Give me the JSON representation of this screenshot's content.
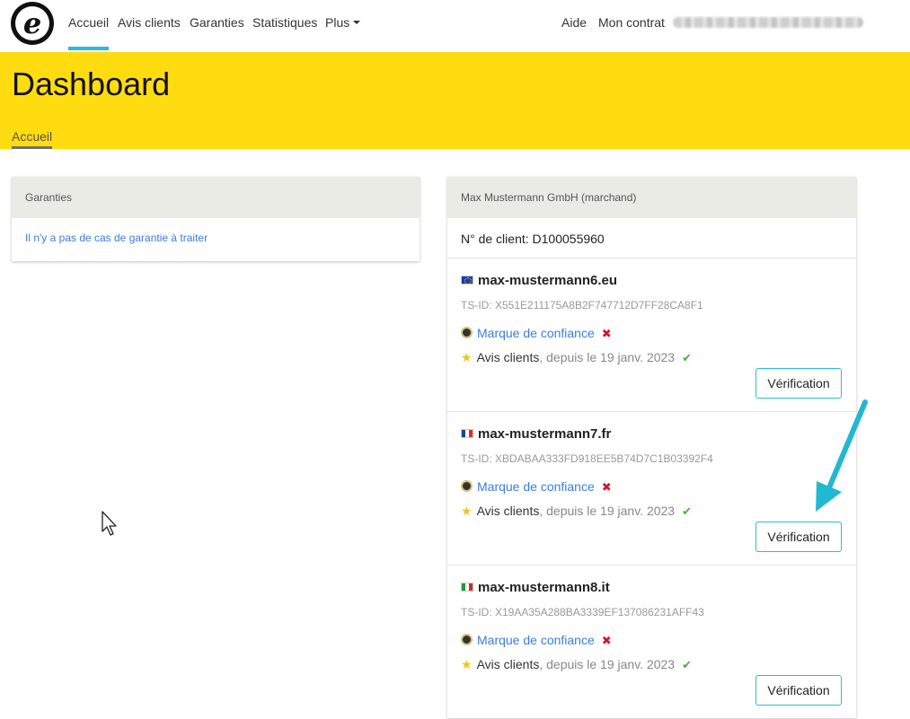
{
  "nav": {
    "logo_letter": "e",
    "items": [
      "Accueil",
      "Avis clients",
      "Garanties",
      "Statistiques",
      "Plus"
    ],
    "right": [
      "Aide",
      "Mon contrat"
    ]
  },
  "header": {
    "title": "Dashboard",
    "breadcrumb": "Accueil"
  },
  "guarantees": {
    "title": "Garanties",
    "message": "Il n'y a pas de cas de garantie à traiter"
  },
  "merchant": {
    "title": "Max Mustermann GmbH (marchand)",
    "client_number": "N° de client: D100055960",
    "shops": [
      {
        "flag": "eu",
        "domain": "max-mustermann6.eu",
        "ts_id": "TS-ID: X551E211175A8B2F747712D7FF28CA8F1",
        "trustmark_label": "Marque de confiance",
        "trustmark_status": "✖",
        "reviews_label": "Avis clients",
        "reviews_since": ", depuis le 19 janv. 2023",
        "reviews_status": "✔",
        "button": "Vérification"
      },
      {
        "flag": "fr",
        "domain": "max-mustermann7.fr",
        "ts_id": "TS-ID: XBDABAA333FD918EE5B74D7C1B03392F4",
        "trustmark_label": "Marque de confiance",
        "trustmark_status": "✖",
        "reviews_label": "Avis clients",
        "reviews_since": ", depuis le 19 janv. 2023",
        "reviews_status": "✔",
        "button": "Vérification"
      },
      {
        "flag": "it",
        "domain": "max-mustermann8.it",
        "ts_id": "TS-ID: X19AA35A288BA3339EF137086231AFF43",
        "trustmark_label": "Marque de confiance",
        "trustmark_status": "✖",
        "reviews_label": "Avis clients",
        "reviews_since": ", depuis le 19 janv. 2023",
        "reviews_status": "✔",
        "button": "Vérification"
      }
    ]
  },
  "colors": {
    "accent": "#2bbbd8",
    "header_bg": "#ffdc0f",
    "link": "#3b7ddd",
    "error": "#d0172a",
    "success": "#4caf3d"
  }
}
